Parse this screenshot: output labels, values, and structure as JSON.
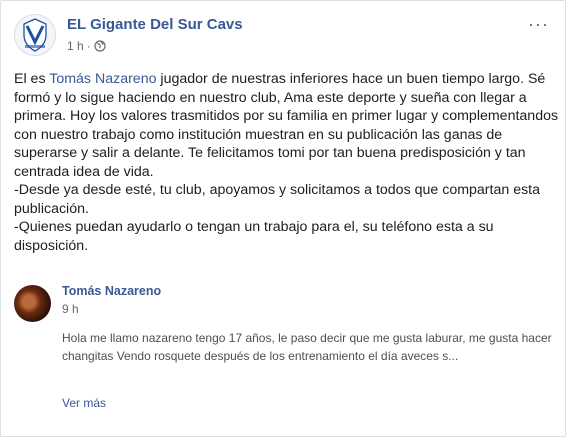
{
  "post": {
    "page_name": "EL Gigante Del Sur Cavs",
    "time": "1 h",
    "separator": "·",
    "more_label": "···",
    "text_intro": "El es ",
    "mention": "Tomás Nazareno",
    "text_rest": " jugador de nuestras inferiores hace un buen tiempo largo. Sé formó y lo sigue haciendo en nuestro club, Ama este deporte y sueña con llegar a primera. Hoy los valores trasmitidos por su familia en primer lugar y complementandos con nuestro trabajo como institución muestran en su publicación las ganas de superarse y salir a delante. Te felicitamos tomi por tan buena predisposición y tan centrada idea de vida.",
    "paragraph_2": "-Desde ya desde esté, tu club, apoyamos y solicitamos a todos que compartan esta publicación.",
    "paragraph_3": "-Quienes puedan ayudarlo o tengan un trabajo para el, su teléfono esta a su disposición."
  },
  "comment": {
    "author": "Tomás Nazareno",
    "time": "9 h",
    "text": "Hola me llamo nazareno tengo 17 años, le paso decir que me gusta laburar, me gusta hacer changitas Vendo rosquete después de los entrenamiento el día aveces s...",
    "see_more": "Ver más"
  },
  "icons": {
    "privacy": "globe-icon",
    "page_logo": "club-logo",
    "options": "more-options-icon"
  },
  "colors": {
    "link": "#385898",
    "text": "#1c1e21",
    "meta": "#606770"
  }
}
